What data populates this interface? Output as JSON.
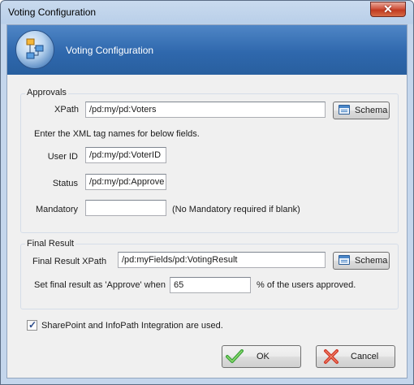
{
  "window": {
    "title": "Voting Configuration",
    "close_glyph": "✕"
  },
  "header": {
    "title": "Voting Configuration",
    "icon": "workflow-approval-icon"
  },
  "approvals": {
    "group_title": "Approvals",
    "xpath_label": "XPath",
    "xpath_value": "/pd:my/pd:Voters",
    "schema_button": "Schema",
    "instruction": "Enter the XML tag names for below fields.",
    "user_id_label": "User ID",
    "user_id_value": "/pd:my/pd:VoterID",
    "status_label": "Status",
    "status_value": "/pd:my/pd:Approve",
    "mandatory_label": "Mandatory",
    "mandatory_value": "",
    "mandatory_note": "(No Mandatory required if blank)"
  },
  "final_result": {
    "group_title": "Final Result",
    "xpath_label": "Final Result XPath",
    "xpath_value": "/pd:myFields/pd:VotingResult",
    "schema_button": "Schema",
    "approve_prefix": "Set final result as 'Approve' when",
    "approve_percent": "65",
    "approve_suffix": "% of the users approved."
  },
  "integration": {
    "checked": true,
    "label": "SharePoint and InfoPath Integration are used."
  },
  "buttons": {
    "ok": "OK",
    "cancel": "Cancel"
  },
  "colors": {
    "header_blue": "#2f68ad",
    "ok_check": "#3aa13a",
    "cancel_x": "#d23a2a"
  }
}
